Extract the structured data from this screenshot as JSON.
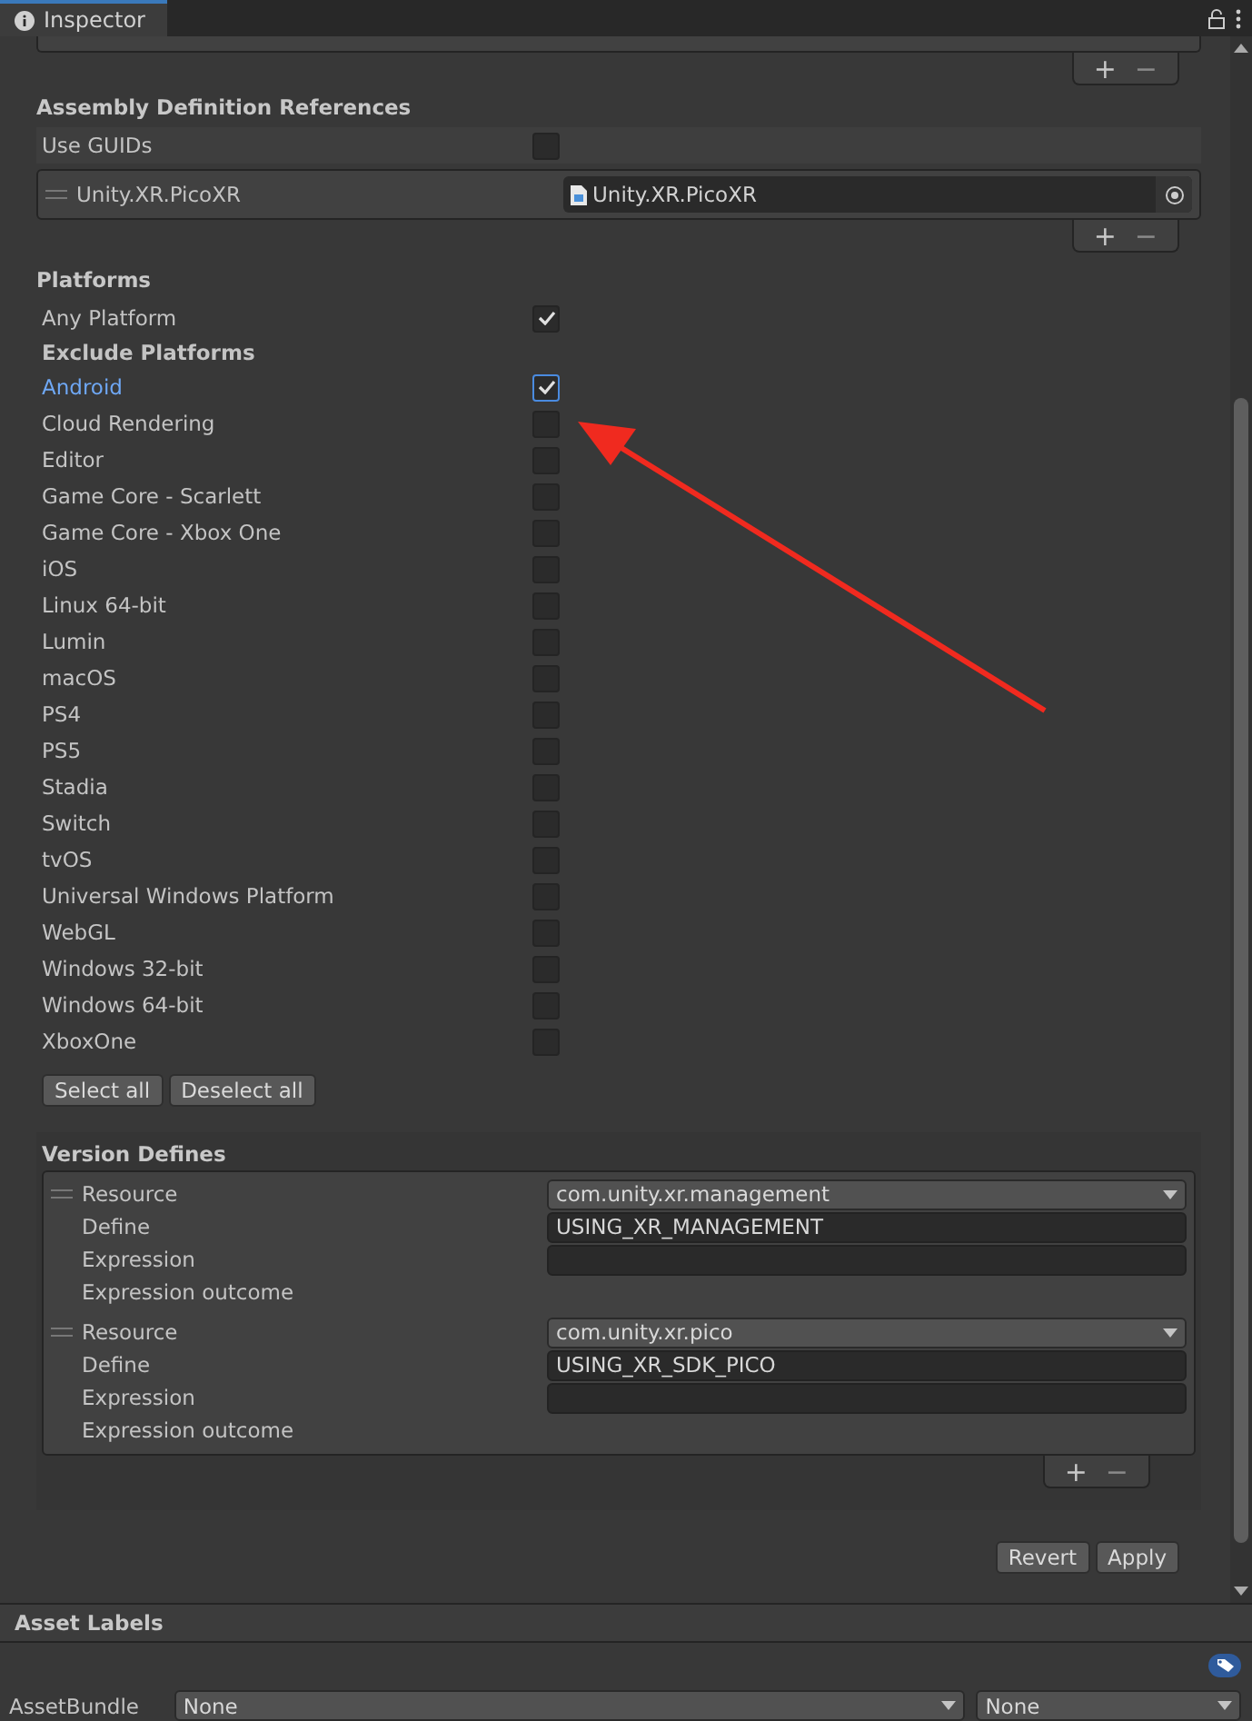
{
  "window": {
    "title": "Inspector"
  },
  "top_list": {
    "footer_buttons": [
      "+",
      "−"
    ]
  },
  "assembly_references": {
    "heading": "Assembly Definition References",
    "use_guids": {
      "label": "Use GUIDs",
      "checked": false
    },
    "items": [
      {
        "name": "Unity.XR.PicoXR",
        "value": "Unity.XR.PicoXR"
      }
    ],
    "footer_buttons": [
      "+",
      "−"
    ]
  },
  "platforms": {
    "heading": "Platforms",
    "any_platform": {
      "label": "Any Platform",
      "checked": true
    },
    "exclude_heading": "Exclude Platforms",
    "items": [
      {
        "label": "Android",
        "checked": true,
        "selected": true
      },
      {
        "label": "Cloud Rendering",
        "checked": false,
        "selected": false
      },
      {
        "label": "Editor",
        "checked": false,
        "selected": false
      },
      {
        "label": "Game Core - Scarlett",
        "checked": false,
        "selected": false
      },
      {
        "label": "Game Core - Xbox One",
        "checked": false,
        "selected": false
      },
      {
        "label": "iOS",
        "checked": false,
        "selected": false
      },
      {
        "label": "Linux 64-bit",
        "checked": false,
        "selected": false
      },
      {
        "label": "Lumin",
        "checked": false,
        "selected": false
      },
      {
        "label": "macOS",
        "checked": false,
        "selected": false
      },
      {
        "label": "PS4",
        "checked": false,
        "selected": false
      },
      {
        "label": "PS5",
        "checked": false,
        "selected": false
      },
      {
        "label": "Stadia",
        "checked": false,
        "selected": false
      },
      {
        "label": "Switch",
        "checked": false,
        "selected": false
      },
      {
        "label": "tvOS",
        "checked": false,
        "selected": false
      },
      {
        "label": "Universal Windows Platform",
        "checked": false,
        "selected": false
      },
      {
        "label": "WebGL",
        "checked": false,
        "selected": false
      },
      {
        "label": "Windows 32-bit",
        "checked": false,
        "selected": false
      },
      {
        "label": "Windows 64-bit",
        "checked": false,
        "selected": false
      },
      {
        "label": "XboxOne",
        "checked": false,
        "selected": false
      }
    ],
    "buttons": [
      "Select all",
      "Deselect all"
    ]
  },
  "version_defines": {
    "heading": "Version Defines",
    "entries": [
      {
        "resource_label": "Resource",
        "resource": "com.unity.xr.management",
        "define_label": "Define",
        "define": "USING_XR_MANAGEMENT",
        "expression_label": "Expression",
        "outcome_label": "Expression outcome"
      },
      {
        "resource_label": "Resource",
        "resource": "com.unity.xr.pico",
        "define_label": "Define",
        "define": "USING_XR_SDK_PICO",
        "expression_label": "Expression",
        "outcome_label": "Expression outcome"
      }
    ],
    "footer_buttons": [
      "+",
      "−"
    ]
  },
  "actions": [
    "Revert",
    "Apply"
  ],
  "asset_labels": {
    "heading": "Asset Labels",
    "asset_bundle": {
      "label": "AssetBundle",
      "value": "None",
      "variant": "None"
    }
  }
}
